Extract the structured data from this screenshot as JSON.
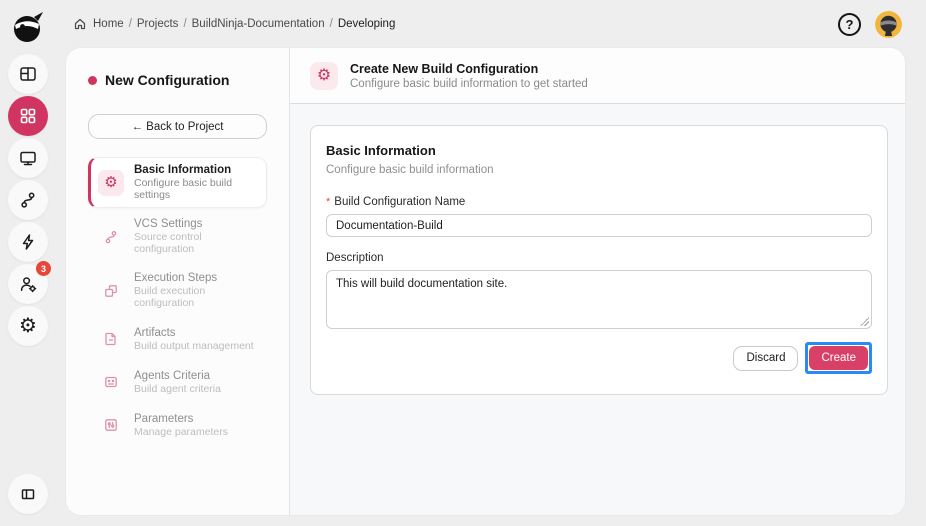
{
  "colors": {
    "accent": "#cf3560",
    "accent_light": "#fbe9ee",
    "create_button": "#d84068",
    "focus_ring": "#2b8bf6",
    "badge": "#e74638",
    "avatar_bg": "#f2b53e"
  },
  "breadcrumb": {
    "separator": "/",
    "items": [
      "Home",
      "Projects",
      "BuildNinja-Documentation",
      "Developing"
    ]
  },
  "topbar": {
    "help_glyph": "?"
  },
  "rail": {
    "items": [
      {
        "name": "layout",
        "icon": "layout-icon"
      },
      {
        "name": "projects",
        "icon": "grid-icon",
        "active": true
      },
      {
        "name": "agents",
        "icon": "monitor-icon"
      },
      {
        "name": "vcs",
        "icon": "git-branch-icon"
      },
      {
        "name": "builds",
        "icon": "lightning-icon"
      },
      {
        "name": "users",
        "icon": "user-gear-icon",
        "badge": "3"
      },
      {
        "name": "settings",
        "icon": "gear-icon"
      }
    ],
    "bottom": {
      "name": "collapse",
      "icon": "panel-collapse-icon"
    }
  },
  "sidebar": {
    "title": "New Configuration",
    "back_label": "← Back to Project",
    "items": [
      {
        "label": "Basic Information",
        "sub": "Configure basic build settings",
        "active": true
      },
      {
        "label": "VCS Settings",
        "sub": "Source control configuration"
      },
      {
        "label": "Execution Steps",
        "sub": "Build execution configuration"
      },
      {
        "label": "Artifacts",
        "sub": "Build output management"
      },
      {
        "label": "Agents Criteria",
        "sub": "Build agent criteria"
      },
      {
        "label": "Parameters",
        "sub": "Manage parameters"
      }
    ]
  },
  "header": {
    "title": "Create New Build Configuration",
    "subtitle": "Configure basic build information to get started"
  },
  "form": {
    "section_title": "Basic Information",
    "section_subtitle": "Configure basic build information",
    "name_required_mark": "*",
    "name_label": "Build Configuration Name",
    "name_value": "Documentation-Build",
    "description_label": "Description",
    "description_value": "This will build documentation site.",
    "discard_label": "Discard",
    "create_label": "Create"
  }
}
